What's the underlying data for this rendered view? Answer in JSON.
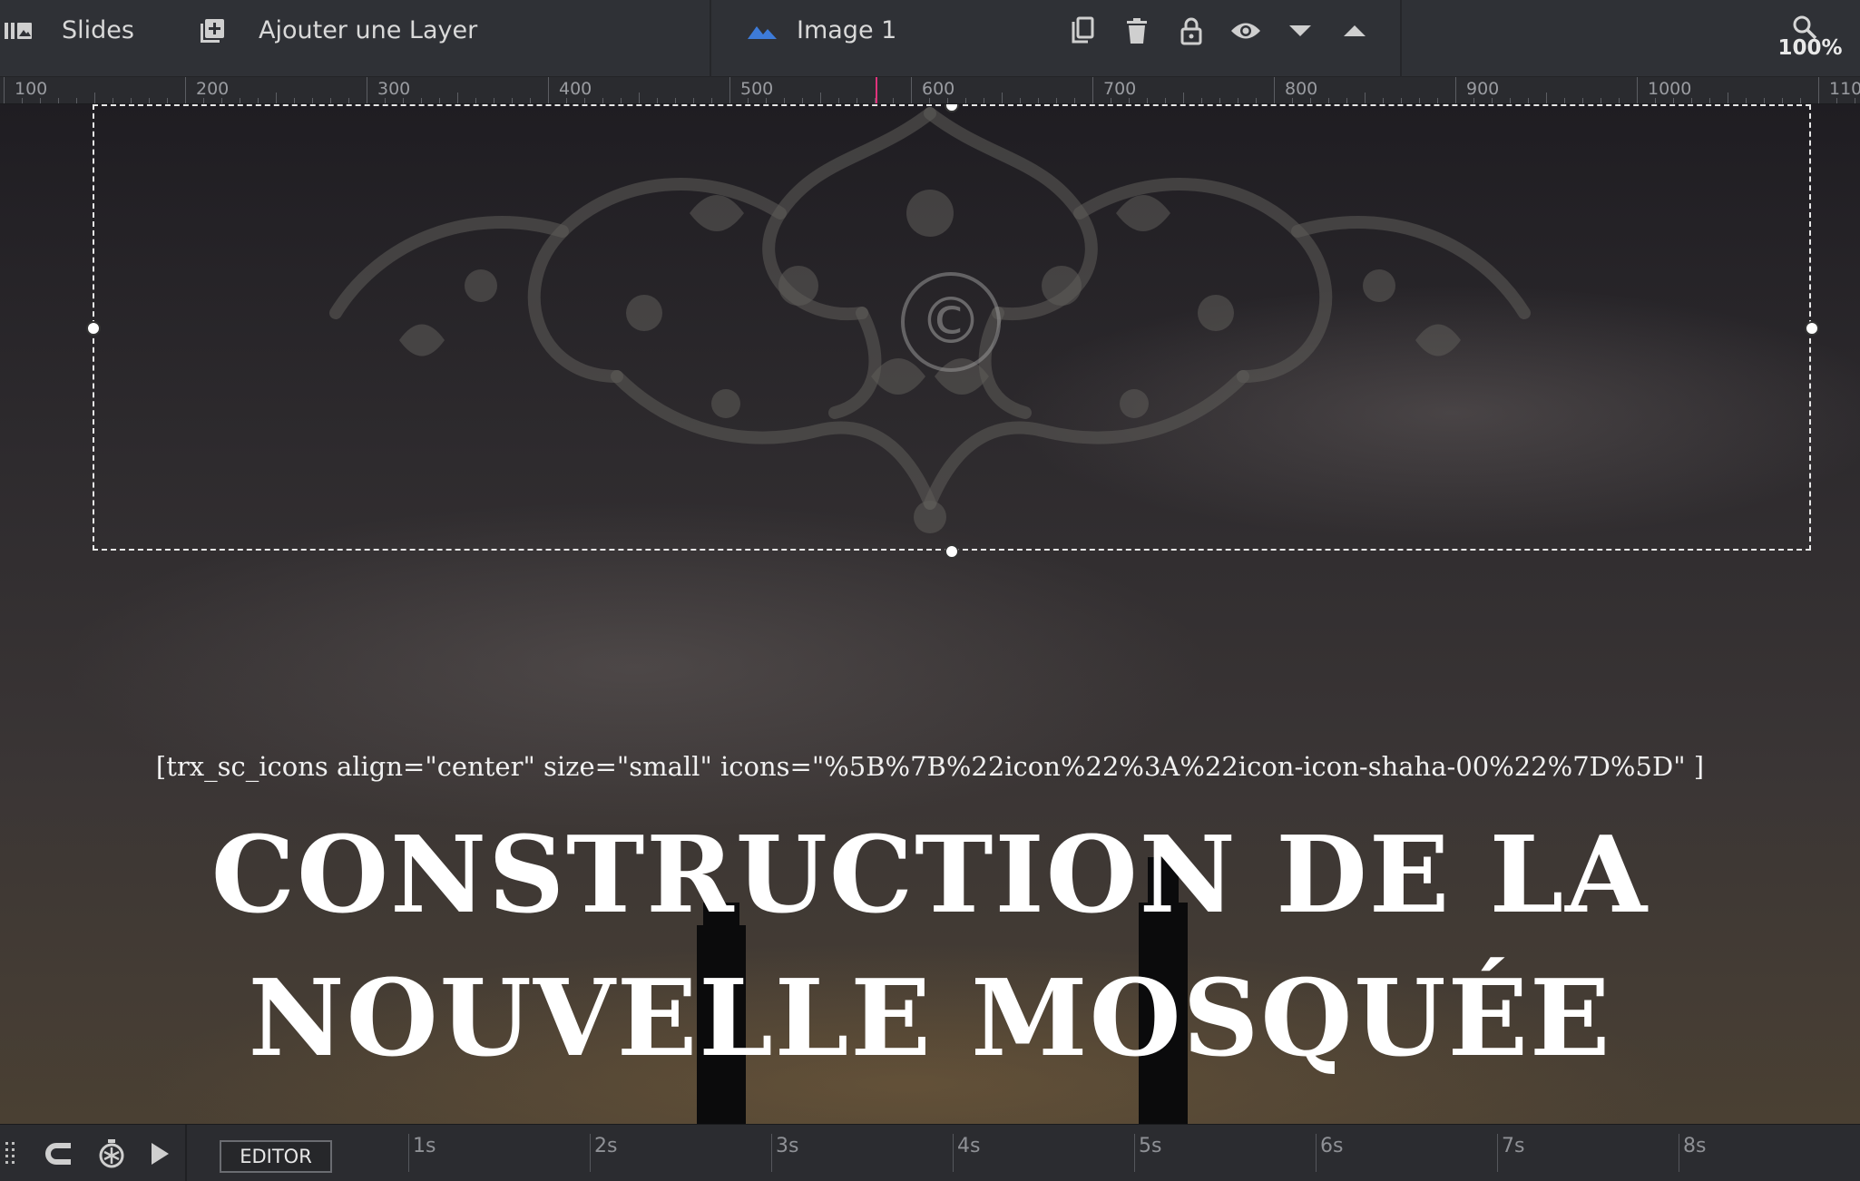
{
  "toolbar": {
    "slides_label": "Slides",
    "add_layer_label": "Ajouter une Layer",
    "layer_name": "Image 1",
    "zoom": "100%"
  },
  "ruler": {
    "labels": [
      "100",
      "200",
      "300",
      "400",
      "500",
      "600",
      "700",
      "800",
      "900",
      "1000",
      "110"
    ]
  },
  "canvas": {
    "shortcode": "[trx_sc_icons align=\"center\" size=\"small\" icons=\"%5B%7B%22icon%22%3A%22icon-icon-shaha-00%22%7D%5D\" ]",
    "headline_line1": "CONSTRUCTION DE LA",
    "headline_line2": "NOUVELLE MOSQUÉE",
    "watermark": "©"
  },
  "timeline": {
    "editor_label": "EDITOR",
    "labels": [
      "1s",
      "2s",
      "3s",
      "4s",
      "5s",
      "6s",
      "7s",
      "8s"
    ]
  },
  "colors": {
    "toolbar_bg": "#2f3136",
    "accent_blue": "#3d7bd9",
    "ruler_marker": "#e0337c"
  }
}
